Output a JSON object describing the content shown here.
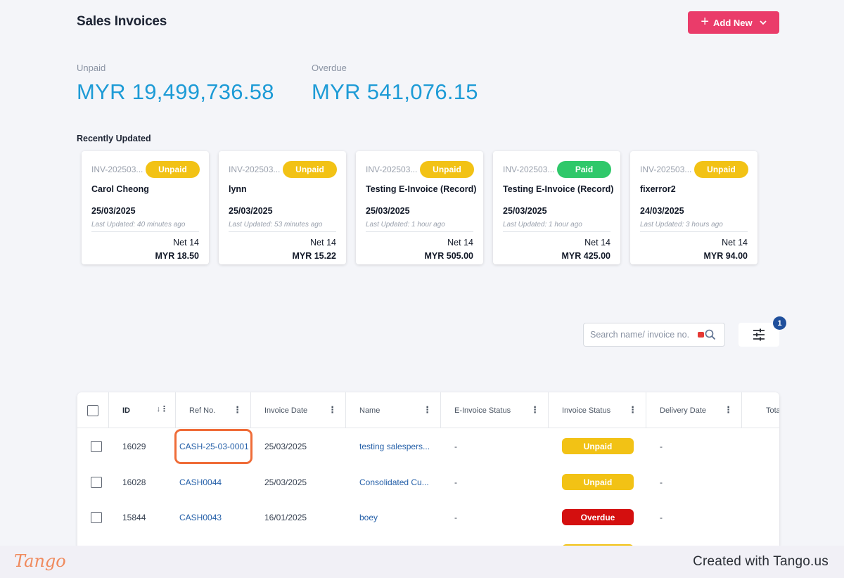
{
  "page": {
    "title": "Sales Invoices",
    "add_new_label": "Add New"
  },
  "summary": {
    "unpaid_label": "Unpaid",
    "unpaid_value": "MYR 19,499,736.58",
    "overdue_label": "Overdue",
    "overdue_value": "MYR 541,076.15"
  },
  "recent": {
    "title": "Recently Updated",
    "cards": [
      {
        "invoice_no": "INV-202503...",
        "status": "Unpaid",
        "status_color": "#f2c215",
        "name": "Carol Cheong",
        "date": "25/03/2025",
        "updated": "Last Updated: 40 minutes ago",
        "terms": "Net 14",
        "amount": "MYR 18.50"
      },
      {
        "invoice_no": "INV-202503...",
        "status": "Unpaid",
        "status_color": "#f2c215",
        "name": "lynn",
        "date": "25/03/2025",
        "updated": "Last Updated: 53 minutes ago",
        "terms": "Net 14",
        "amount": "MYR 15.22"
      },
      {
        "invoice_no": "INV-202503...",
        "status": "Unpaid",
        "status_color": "#f2c215",
        "name": "Testing E-Invoice (Record)",
        "date": "25/03/2025",
        "updated": "Last Updated: 1 hour ago",
        "terms": "Net 14",
        "amount": "MYR 505.00"
      },
      {
        "invoice_no": "INV-202503...",
        "status": "Paid",
        "status_color": "#2fc86a",
        "name": "Testing E-Invoice (Record)",
        "date": "25/03/2025",
        "updated": "Last Updated: 1 hour ago",
        "terms": "Net 14",
        "amount": "MYR 425.00"
      },
      {
        "invoice_no": "INV-202503...",
        "status": "Unpaid",
        "status_color": "#f2c215",
        "name": "fixerror2",
        "date": "24/03/2025",
        "updated": "Last Updated: 3 hours ago",
        "terms": "Net 14",
        "amount": "MYR 94.00"
      }
    ]
  },
  "search": {
    "placeholder": "Search name/ invoice no."
  },
  "filter": {
    "count": "1"
  },
  "table": {
    "columns": [
      "ID",
      "Ref No.",
      "Invoice Date",
      "Name",
      "E-Invoice Status",
      "Invoice Status",
      "Delivery Date",
      "Tota"
    ],
    "rows": [
      {
        "id": "16029",
        "ref": "CASH-25-03-0001",
        "date": "25/03/2025",
        "name": "testing salespers...",
        "einvoice": "-",
        "status": "Unpaid",
        "status_color": "#f2c215",
        "delivery": "-"
      },
      {
        "id": "16028",
        "ref": "CASH0044",
        "date": "25/03/2025",
        "name": "Consolidated Cu...",
        "einvoice": "-",
        "status": "Unpaid",
        "status_color": "#f2c215",
        "delivery": "-"
      },
      {
        "id": "15844",
        "ref": "CASH0043",
        "date": "16/01/2025",
        "name": "boey",
        "einvoice": "-",
        "status": "Overdue",
        "status_color": "#d40f0f",
        "delivery": "-"
      }
    ]
  },
  "footer": {
    "logo": "Tango",
    "credit": "Created with Tango.us"
  }
}
